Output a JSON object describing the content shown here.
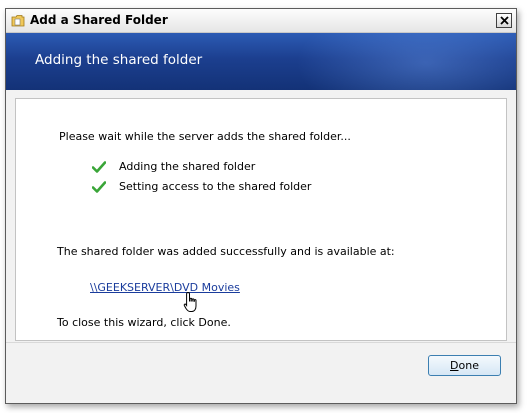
{
  "window": {
    "title": "Add a Shared Folder",
    "icon": "folder-share-icon"
  },
  "banner": {
    "title": "Adding the shared folder"
  },
  "content": {
    "intro": "Please wait while the server adds the shared folder...",
    "steps": [
      {
        "label": "Adding the shared folder",
        "status": "done"
      },
      {
        "label": "Setting access to the shared folder",
        "status": "done"
      }
    ],
    "success_message": "The shared folder was added successfully and is available at:",
    "share_path": "\\\\GEEKSERVER\\DVD Movies",
    "close_instruction": "To close this wizard, click Done."
  },
  "footer": {
    "done_label_accel": "D",
    "done_label_rest": "one"
  },
  "colors": {
    "banner_top": "#2c5bb4",
    "banner_bottom": "#133277",
    "link": "#1a3c9c",
    "check": "#3aa538"
  }
}
